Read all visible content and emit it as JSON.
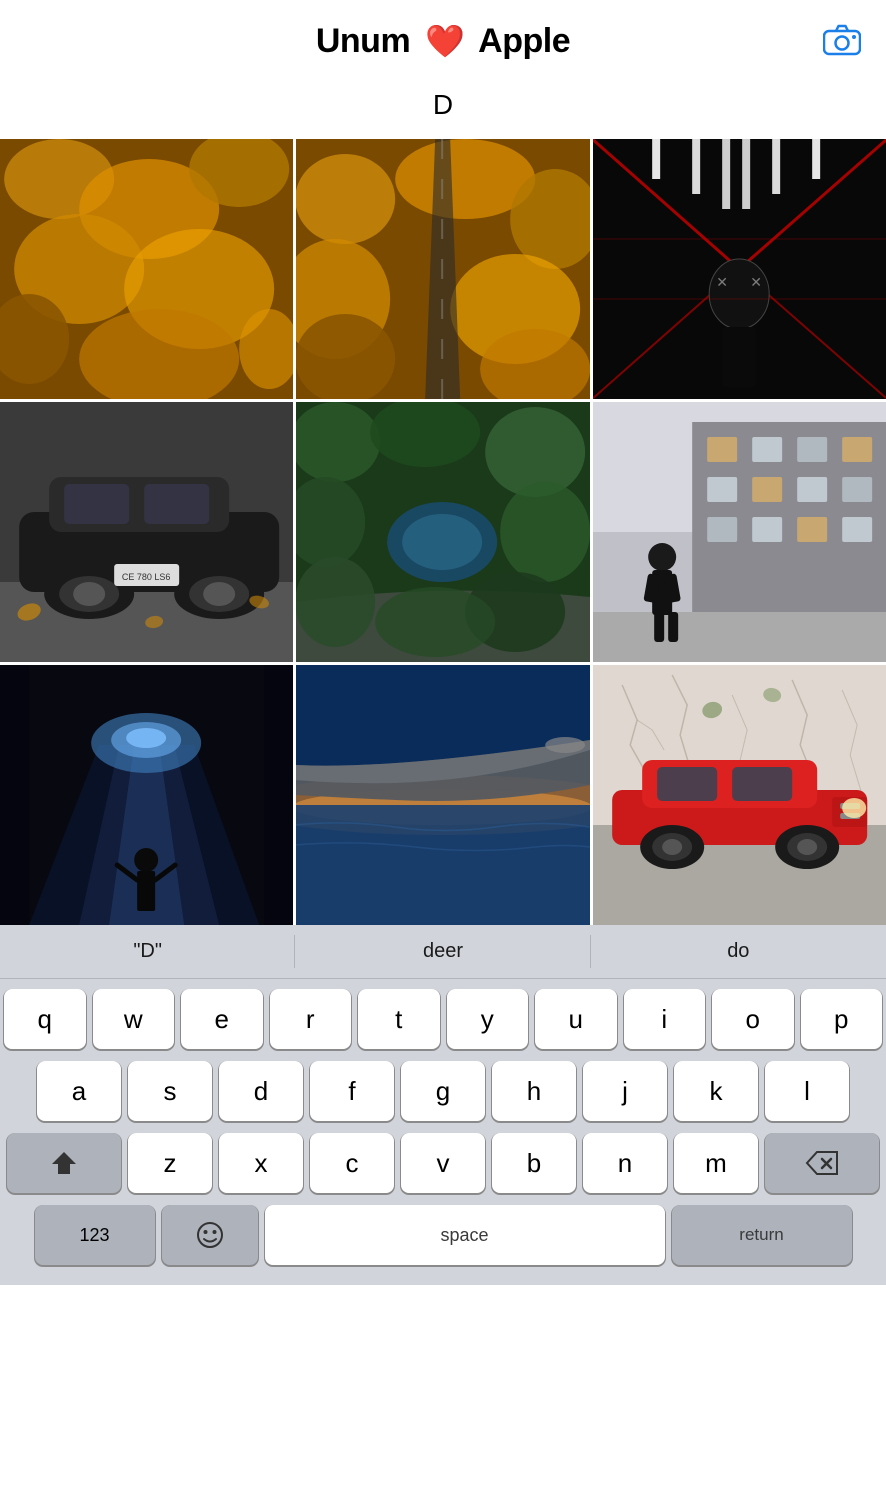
{
  "header": {
    "title_left": "Unum",
    "heart": "❤️",
    "title_right": "Apple",
    "camera_icon": "📷"
  },
  "search": {
    "value": "D",
    "placeholder": ""
  },
  "photos": [
    {
      "id": 1,
      "description": "aerial autumn forest"
    },
    {
      "id": 2,
      "description": "aerial road through autumn forest"
    },
    {
      "id": 3,
      "description": "person in tunnel with mask"
    },
    {
      "id": 4,
      "description": "classic black car with autumn leaves"
    },
    {
      "id": 5,
      "description": "aerial green forest with lake"
    },
    {
      "id": 6,
      "description": "person standing by building"
    },
    {
      "id": 7,
      "description": "person with light rays"
    },
    {
      "id": 8,
      "description": "airplane wing over ocean"
    },
    {
      "id": 9,
      "description": "red car parked by wall"
    }
  ],
  "autocorrect": {
    "item1": "\"D\"",
    "item2": "deer",
    "item3": "do"
  },
  "keyboard": {
    "row1": [
      "q",
      "w",
      "e",
      "r",
      "t",
      "y",
      "u",
      "i",
      "o",
      "p"
    ],
    "row2": [
      "a",
      "s",
      "d",
      "f",
      "g",
      "h",
      "j",
      "k",
      "l"
    ],
    "row3": [
      "z",
      "x",
      "c",
      "v",
      "b",
      "n",
      "m"
    ],
    "shift_icon": "⇧",
    "delete_icon": "⌫",
    "key_123": "123",
    "key_emoji": "☺",
    "key_space": "space",
    "key_return": "return"
  },
  "colors": {
    "accent_blue": "#1a7fe8",
    "keyboard_bg": "#d1d5db",
    "key_bg": "#ffffff",
    "special_key_bg": "#adb2bb"
  }
}
